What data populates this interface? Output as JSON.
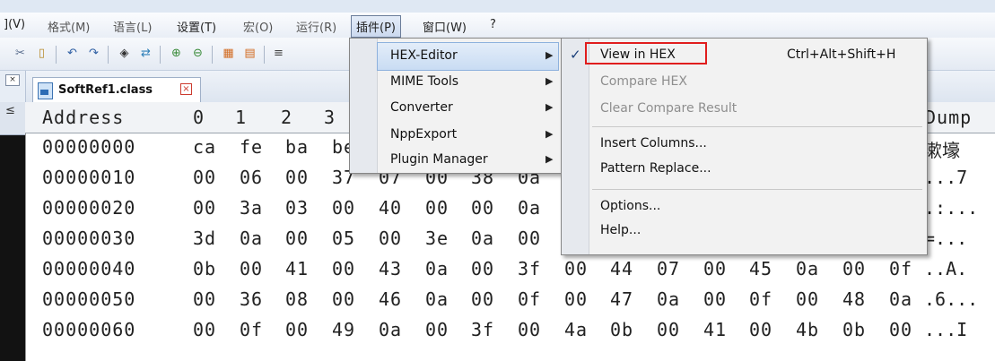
{
  "menubar": {
    "items": [
      "](V)",
      "格式(M)",
      "语言(L)",
      "设置(T)",
      "宏(O)",
      "运行(R)",
      "插件(P)",
      "窗口(W)",
      "?"
    ]
  },
  "toolbar": {
    "icons": [
      "cut-icon",
      "paste-icon",
      "undo-icon",
      "redo-icon",
      "find-icon",
      "replace-icon",
      "zoom-in-icon",
      "zoom-out-icon",
      "sync-v-icon",
      "sync-h-icon",
      "wrap-icon"
    ]
  },
  "tab": {
    "filename": "SoftRef1.class",
    "close_glyph": "x"
  },
  "hex_view": {
    "header": {
      "address": "Address",
      "columns": [
        "0",
        "1",
        "2",
        "3"
      ],
      "dump": "Dump"
    },
    "rows": [
      {
        "addr": "00000000",
        "bytes": [
          "ca",
          "fe",
          "ba",
          "be"
        ],
        "dump": "漱壕"
      },
      {
        "addr": "00000010",
        "bytes": [
          "00",
          "06",
          "00",
          "37",
          "07",
          "00",
          "38",
          "0a",
          "0"
        ],
        "dump": "...7"
      },
      {
        "addr": "00000020",
        "bytes": [
          "00",
          "3a",
          "03",
          "00",
          "40",
          "00",
          "00",
          "0a",
          "0"
        ],
        "dump": ".:..."
      },
      {
        "addr": "00000030",
        "bytes": [
          "3d",
          "0a",
          "00",
          "05",
          "00",
          "3e",
          "0a",
          "00",
          "3"
        ],
        "dump": "=..."
      },
      {
        "addr": "00000040",
        "bytes": [
          "0b",
          "00",
          "41",
          "00",
          "43",
          "0a",
          "00",
          "3f",
          "00",
          "44",
          "07",
          "00",
          "45",
          "0a",
          "00",
          "0f"
        ],
        "dump": "..A."
      },
      {
        "addr": "00000050",
        "bytes": [
          "00",
          "36",
          "08",
          "00",
          "46",
          "0a",
          "00",
          "0f",
          "00",
          "47",
          "0a",
          "00",
          "0f",
          "00",
          "48",
          "0a"
        ],
        "dump": ".6..."
      },
      {
        "addr": "00000060",
        "bytes": [
          "00",
          "0f",
          "00",
          "49",
          "0a",
          "00",
          "3f",
          "00",
          "4a",
          "0b",
          "00",
          "41",
          "00",
          "4b",
          "0b",
          "00"
        ],
        "dump": "...I"
      }
    ]
  },
  "plugins_menu": {
    "items": [
      {
        "label": "HEX-Editor",
        "submenu": true,
        "highlighted": true
      },
      {
        "label": "MIME Tools",
        "submenu": true
      },
      {
        "label": "Converter",
        "submenu": true
      },
      {
        "label": "NppExport",
        "submenu": true
      },
      {
        "label": "Plugin Manager",
        "submenu": true
      }
    ],
    "arrow": "▶"
  },
  "hex_submenu": {
    "check_glyph": "✓",
    "view_in_hex": {
      "label": "View in HEX",
      "shortcut": "Ctrl+Alt+Shift+H",
      "checked": true
    },
    "compare_hex": {
      "label": "Compare HEX",
      "disabled": true
    },
    "clear_compare": {
      "label": "Clear Compare Result",
      "disabled": true
    },
    "insert_columns": {
      "label": "Insert Columns..."
    },
    "pattern_replace": {
      "label": "Pattern Replace..."
    },
    "options": {
      "label": "Options..."
    },
    "help": {
      "label": "Help..."
    }
  },
  "colors": {
    "highlight_box": "#e01d1d",
    "menu_bg": "#f2f2f2",
    "check": "#1a3f7a"
  }
}
